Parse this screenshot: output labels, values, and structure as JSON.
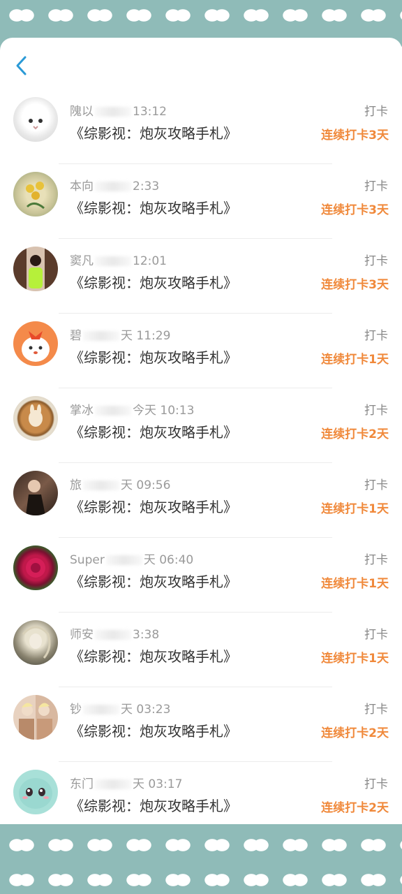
{
  "header": {
    "back_icon": "chevron-left-icon"
  },
  "rows": [
    {
      "name": "隗以",
      "time": "13:12",
      "title": "《综影视：炮灰攻略手札》",
      "action": "打卡",
      "streak": "连续打卡3天",
      "avatar": "white-cat"
    },
    {
      "name": "本向",
      "time": "2:33",
      "title": "《综影视：炮灰攻略手札》",
      "action": "打卡",
      "streak": "连续打卡3天",
      "avatar": "yellow-flowers"
    },
    {
      "name": "窦凡",
      "time": "12:01",
      "title": "《综影视：炮灰攻略手札》",
      "action": "打卡",
      "streak": "连续打卡3天",
      "avatar": "girl-green-dress"
    },
    {
      "name": "碧",
      "time": "天 11:29",
      "title": "《综影视：炮灰攻略手札》",
      "action": "打卡",
      "streak": "连续打卡1天",
      "avatar": "cartoon-dog"
    },
    {
      "name": "掌冰",
      "time": "今天 10:13",
      "title": "《综影视：炮灰攻略手札》",
      "action": "打卡",
      "streak": "连续打卡2天",
      "avatar": "latte-art"
    },
    {
      "name": "旅",
      "time": "天 09:56",
      "title": "《综影视：炮灰攻略手札》",
      "action": "打卡",
      "streak": "连续打卡1天",
      "avatar": "dark-portrait"
    },
    {
      "name": "Super",
      "time": "天 06:40",
      "title": "《综影视：炮灰攻略手札》",
      "action": "打卡",
      "streak": "连续打卡1天",
      "avatar": "red-peony"
    },
    {
      "name": "师安",
      "time": "3:38",
      "title": "《综影视：炮灰攻略手札》",
      "action": "打卡",
      "streak": "连续打卡1天",
      "avatar": "sketch-portrait"
    },
    {
      "name": "钞",
      "time": "天 03:23",
      "title": "《综影视：炮灰攻略手札》",
      "action": "打卡",
      "streak": "连续打卡2天",
      "avatar": "two-people"
    },
    {
      "name": "东门",
      "time": "天 03:17",
      "title": "《综影视：炮灰攻略手札》",
      "action": "打卡",
      "streak": "连续打卡2天",
      "avatar": "cartoon-squirtle"
    }
  ],
  "colors": {
    "accent": "#f0893b",
    "back": "#2a9ad6",
    "pattern": "#8fbbb8"
  }
}
